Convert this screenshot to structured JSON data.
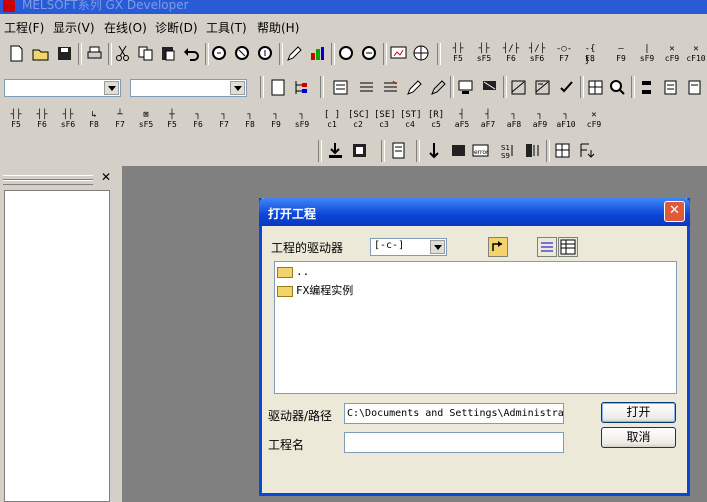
{
  "app": {
    "title": "MELSOFT系列 GX Developer"
  },
  "menu": [
    {
      "label": "工程(F)"
    },
    {
      "label": "显示(V)"
    },
    {
      "label": "在线(O)"
    },
    {
      "label": "诊断(D)"
    },
    {
      "label": "工具(T)"
    },
    {
      "label": "帮助(H)"
    }
  ],
  "ladder_keys_row1": [
    {
      "sym": "┤├",
      "label": "F5"
    },
    {
      "sym": "┤├",
      "label": "sF5"
    },
    {
      "sym": "┤/├",
      "label": "F6"
    },
    {
      "sym": "┤/├",
      "label": "sF6"
    },
    {
      "sym": "-○-",
      "label": "F7"
    },
    {
      "sym": "-{ }-",
      "label": "F8"
    },
    {
      "sym": "—",
      "label": "F9"
    },
    {
      "sym": "|",
      "label": "sF9"
    },
    {
      "sym": "✕",
      "label": "cF9"
    },
    {
      "sym": "✕",
      "label": "cF10"
    }
  ],
  "ladder_keys_row3": [
    {
      "sym": "┤├",
      "label": "F5"
    },
    {
      "sym": "┤├",
      "label": "F6"
    },
    {
      "sym": "┤├",
      "label": "sF6"
    },
    {
      "sym": "↳",
      "label": "F8"
    },
    {
      "sym": "┴",
      "label": "F7"
    },
    {
      "sym": "⊠",
      "label": "sF5"
    },
    {
      "sym": "┼",
      "label": "F5"
    },
    {
      "sym": "┐",
      "label": "F6"
    },
    {
      "sym": "┐",
      "label": "F7"
    },
    {
      "sym": "┐",
      "label": "F8"
    },
    {
      "sym": "┐",
      "label": "F9"
    },
    {
      "sym": "┐",
      "label": "sF9"
    },
    {
      "sym": "[ ]",
      "label": "c1"
    },
    {
      "sym": "[SC]",
      "label": "c2"
    },
    {
      "sym": "[SE]",
      "label": "c3"
    },
    {
      "sym": "[ST]",
      "label": "c4"
    },
    {
      "sym": "[R]",
      "label": "c5"
    },
    {
      "sym": "┤",
      "label": "aF5"
    },
    {
      "sym": "┤",
      "label": "aF7"
    },
    {
      "sym": "┐",
      "label": "aF8"
    },
    {
      "sym": "┐",
      "label": "aF9"
    },
    {
      "sym": "┐",
      "label": "aF10"
    },
    {
      "sym": "✕",
      "label": "cF9"
    }
  ],
  "dialog": {
    "title": "打开工程",
    "drive_label": "工程的驱动器",
    "drive_value": "[-c-]",
    "folders": [
      ".. ",
      "FX编程实例"
    ],
    "path_label": "驱动器/路径",
    "path_value": "C:\\Documents and Settings\\Administra",
    "name_label": "工程名",
    "name_value": "",
    "open_label": "打开",
    "cancel_label": "取消",
    "close_glyph": "✕"
  },
  "dock": {
    "close_glyph": "✕"
  },
  "colors": {
    "dialog_title": "#0a46d8",
    "workspace": "#808080",
    "face": "#d4d0c8"
  }
}
